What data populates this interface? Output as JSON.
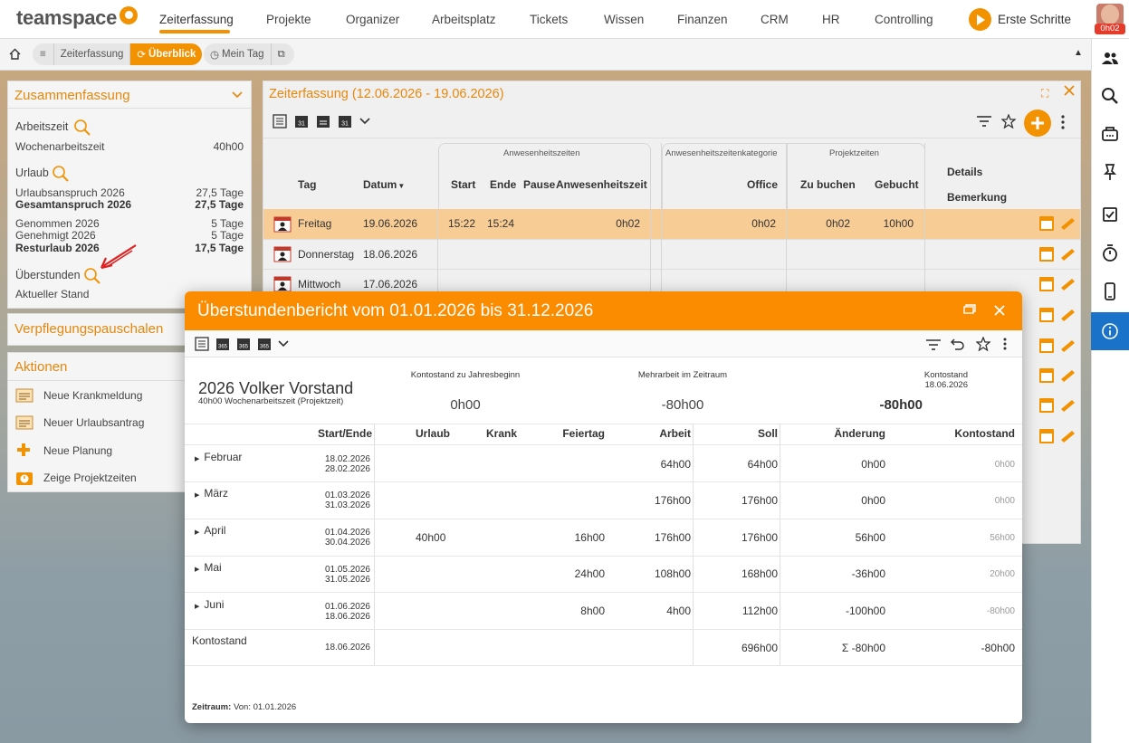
{
  "app": {
    "logo": "teamspace",
    "user_badge": "0h02",
    "accent": "#f39200"
  },
  "nav": [
    "Zeiterfassung",
    "Projekte",
    "Organizer",
    "Arbeitsplatz",
    "Tickets",
    "Wissen",
    "Finanzen",
    "CRM",
    "HR",
    "Controlling"
  ],
  "erste_schritte": "Erste Schritte",
  "subnav": {
    "zeiterfassung": "Zeiterfassung",
    "ueberblick": "Überblick",
    "mein_tag": "Mein Tag"
  },
  "summary": {
    "title": "Zusammenfassung",
    "arbeitszeit": "Arbeitszeit",
    "wochen_label": "Wochenarbeitszeit",
    "wochen_value": "40h00",
    "urlaub": "Urlaub",
    "anspruch_label": "Urlaubsanspruch 2026",
    "anspruch_value": "27,5 Tage",
    "gesamt_label": "Gesamtanspruch 2026",
    "gesamt_value": "27,5 Tage",
    "genommen_label": "Genommen 2026",
    "genommen_value": "5 Tage",
    "genehmigt_label": "Genehmigt 2026",
    "genehmigt_value": "5 Tage",
    "rest_label": "Resturlaub 2026",
    "rest_value": "17,5 Tage",
    "ueberstunden": "Überstunden",
    "aktuell": "Aktueller Stand"
  },
  "verpflegung": {
    "title": "Verpflegungspauschalen"
  },
  "aktionen": {
    "title": "Aktionen",
    "items": [
      "Neue Krankmeldung",
      "Neuer Urlaubsantrag",
      "Neue Planung",
      "Zeige Projektzeiten"
    ]
  },
  "main": {
    "title": "Zeiterfassung (12.06.2026 - 19.06.2026)",
    "groups": {
      "anw": "Anwesenheitszeiten",
      "kat": "Anwesenheitszeitenkategorie",
      "proj": "Projektzeiten"
    },
    "cols": {
      "tag": "Tag",
      "datum": "Datum",
      "start": "Start",
      "ende": "Ende",
      "pause": "Pause",
      "anwz": "Anwesenheitszeit",
      "office": "Office",
      "zubuchen": "Zu buchen",
      "gebucht": "Gebucht",
      "details": "Details",
      "bemerkung": "Bemerkung"
    },
    "rows": [
      {
        "tag": "Freitag",
        "datum": "19.06.2026",
        "start": "15:22",
        "ende": "15:24",
        "anwz": "0h02",
        "office": "0h02",
        "zubuchen": "0h02",
        "gebucht": "10h00"
      },
      {
        "tag": "Donnerstag",
        "datum": "18.06.2026"
      },
      {
        "tag": "Mittwoch",
        "datum": "17.06.2026"
      }
    ]
  },
  "dialog": {
    "title": "Überstundenbericht vom 01.01.2026 bis 31.12.2026",
    "person": "2026 Volker Vorstand",
    "person_sub": "40h00 Wochenarbeitszeit (Projektzeit)",
    "kpi1_label": "Kontostand zu Jahresbeginn",
    "kpi1_value": "0h00",
    "kpi2_label": "Mehrarbeit im Zeitraum",
    "kpi2_value": "-80h00",
    "kpi3_label": "Kontostand",
    "kpi3_date": "18.06.2026",
    "kpi3_value": "-80h00",
    "cols": {
      "startende": "Start/Ende",
      "urlaub": "Urlaub",
      "krank": "Krank",
      "feiertag": "Feiertag",
      "arbeit": "Arbeit",
      "soll": "Soll",
      "aenderung": "Änderung",
      "kontostand": "Kontostand"
    },
    "rows": [
      {
        "month": "Februar",
        "start": "18.02.2026",
        "end": "28.02.2026",
        "urlaub": "",
        "feiertag": "",
        "arbeit": "64h00",
        "soll": "64h00",
        "aenderung": "0h00",
        "konto": "0h00"
      },
      {
        "month": "März",
        "start": "01.03.2026",
        "end": "31.03.2026",
        "urlaub": "",
        "feiertag": "",
        "arbeit": "176h00",
        "soll": "176h00",
        "aenderung": "0h00",
        "konto": "0h00"
      },
      {
        "month": "April",
        "start": "01.04.2026",
        "end": "30.04.2026",
        "urlaub": "40h00",
        "feiertag": "16h00",
        "arbeit": "176h00",
        "soll": "176h00",
        "aenderung": "56h00",
        "konto": "56h00"
      },
      {
        "month": "Mai",
        "start": "01.05.2026",
        "end": "31.05.2026",
        "urlaub": "",
        "feiertag": "24h00",
        "arbeit": "108h00",
        "soll": "168h00",
        "aenderung": "-36h00",
        "konto": "20h00"
      },
      {
        "month": "Juni",
        "start": "01.06.2026",
        "end": "18.06.2026",
        "urlaub": "",
        "feiertag": "8h00",
        "arbeit": "4h00",
        "soll": "112h00",
        "aenderung": "-100h00",
        "konto": "-80h00"
      }
    ],
    "total": {
      "label": "Kontostand",
      "date": "18.06.2026",
      "soll": "696h00",
      "aenderung": "Σ -80h00",
      "konto": "-80h00"
    },
    "footer_label": "Zeitraum:",
    "footer_value": "Von: 01.01.2026"
  }
}
